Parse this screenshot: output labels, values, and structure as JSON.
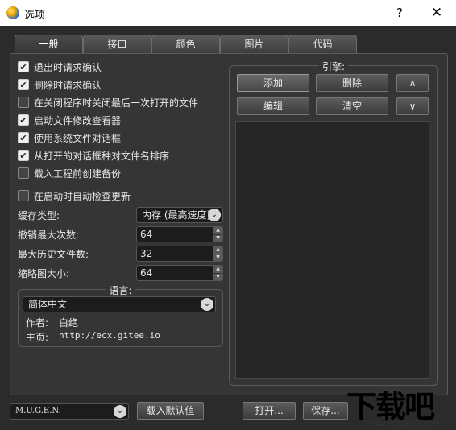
{
  "window": {
    "title": "选项",
    "help": "?",
    "close": "✕"
  },
  "tabs": [
    {
      "label": "一般",
      "active": true
    },
    {
      "label": "接口"
    },
    {
      "label": "颜色"
    },
    {
      "label": "图片"
    },
    {
      "label": "代码"
    }
  ],
  "options": [
    {
      "label": "退出时请求确认",
      "checked": true
    },
    {
      "label": "删除时请求确认",
      "checked": true
    },
    {
      "label": "在关闭程序时关闭最后一次打开的文件",
      "checked": false
    },
    {
      "label": "启动文件修改查看器",
      "checked": true
    },
    {
      "label": "使用系统文件对话框",
      "checked": true
    },
    {
      "label": "从打开的对话框种对文件名排序",
      "checked": true
    },
    {
      "label": "载入工程前创建备份",
      "checked": false
    },
    {
      "label": "在启动时自动检查更新",
      "checked": false
    }
  ],
  "settings": {
    "cache_label": "缓存类型:",
    "cache_value": "内存 (最高速度)",
    "undo_label": "撤销最大次数:",
    "undo_value": "64",
    "history_label": "最大历史文件数:",
    "history_value": "32",
    "thumb_label": "缩略图大小:",
    "thumb_value": "64"
  },
  "language": {
    "title": "语言:",
    "value": "简体中文",
    "author_label": "作者:",
    "author_value": "白绝",
    "home_label": "主页:",
    "home_value": "http://ecx.gitee.io"
  },
  "engine": {
    "title": "引擎:",
    "add": "添加",
    "delete": "删除",
    "up": "∧",
    "edit": "编辑",
    "clear": "清空",
    "down": "∨"
  },
  "footer": {
    "profile_value": "M.U.G.E.N.",
    "load_defaults": "载入默认值",
    "open": "打开...",
    "save": "保存..."
  },
  "watermark": {
    "text": "下载吧",
    "url": "www.xiazaiba.com"
  }
}
